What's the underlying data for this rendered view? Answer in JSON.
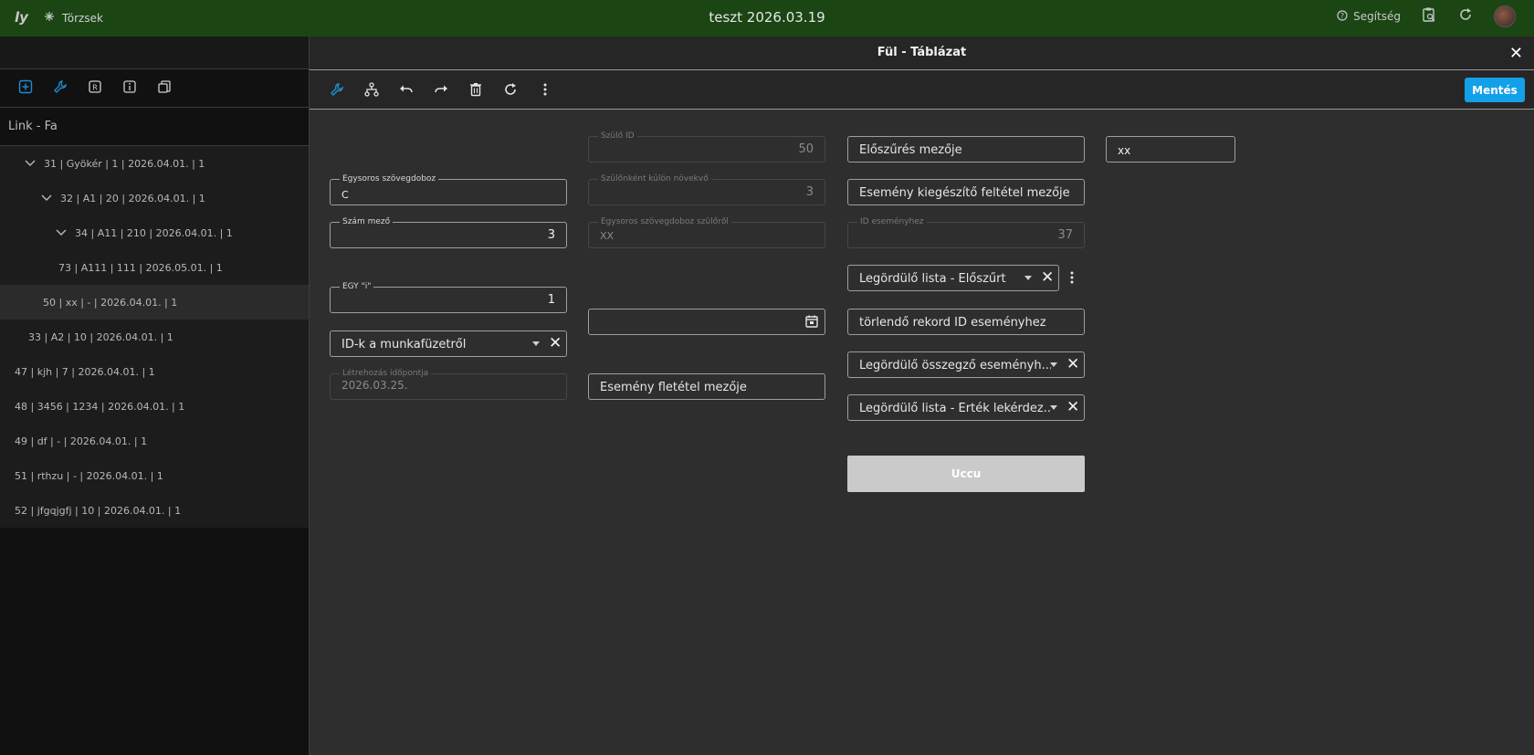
{
  "topbar": {
    "logo": "ly",
    "torzsek": "Törzsek",
    "title": "teszt 2026.03.19",
    "help": "Segítség"
  },
  "sidebar": {
    "title": "Link - Fa",
    "tree": [
      {
        "label": "31 | Gyökér | 1 | 2026.04.01. | 1",
        "indent": 1,
        "expanded": true
      },
      {
        "label": "32 | A1 | 20 | 2026.04.01. | 1",
        "indent": 2,
        "expanded": true
      },
      {
        "label": "34 | A11 | 210 | 2026.04.01. | 1",
        "indent": 3,
        "expanded": true
      },
      {
        "label": "73 | A111 | 111 | 2026.05.01. | 1",
        "indent": 4,
        "expanded": false
      },
      {
        "label": "50 | xx | - | 2026.04.01. | 1",
        "indent": 3,
        "expanded": false,
        "selected": true
      },
      {
        "label": "33 | A2 | 10 | 2026.04.01. | 1",
        "indent": 2,
        "expanded": false
      },
      {
        "label": "47 | kjh | 7 | 2026.04.01. | 1",
        "indent": 0,
        "expanded": false
      },
      {
        "label": "48 | 3456 | 1234 | 2026.04.01. | 1",
        "indent": 0,
        "expanded": false
      },
      {
        "label": "49 | df | - | 2026.04.01. | 1",
        "indent": 0,
        "expanded": false
      },
      {
        "label": "51 | rthzu | - | 2026.04.01. | 1",
        "indent": 0,
        "expanded": false
      },
      {
        "label": "52 | jfgqjgfj | 10 | 2026.04.01. | 1",
        "indent": 0,
        "expanded": false
      }
    ]
  },
  "main": {
    "title": "Fül - Táblázat",
    "save_label": "Mentés"
  },
  "form": {
    "egysoros": {
      "label": "Egysoros szövegdoboz",
      "value": "C"
    },
    "szam": {
      "label": "Szám mező",
      "value": "3"
    },
    "egy_i": {
      "label": "EGY \"i\"",
      "value": "1"
    },
    "idk": {
      "placeholder": "ID-k a munkafüzetről"
    },
    "letrehozas": {
      "label": "Létrehozás időpontja",
      "value": "2026.03.25."
    },
    "szulo_id": {
      "label": "Szülő ID",
      "value": "50"
    },
    "szulonkent": {
      "label": "Szülőnként külön növekvő",
      "value": "3"
    },
    "egysoros_szulo": {
      "label": "Egysoros szövegdoboz szülőről",
      "value": "XX"
    },
    "esemeny_feltetel": {
      "placeholder": "Esemény fletétel mezője"
    },
    "eloszures": {
      "placeholder": "Előszűrés mezője"
    },
    "esemeny_kieg": {
      "placeholder": "Esemény kiegészítő feltétel mezője"
    },
    "id_esemeny": {
      "label": "ID eseményhez",
      "value": "37"
    },
    "legordulo_eloszurt": {
      "placeholder": "Legördülő lista - Előszűrt"
    },
    "torlendo": {
      "placeholder": "törlendő rekord ID eseményhez"
    },
    "legordulo_osszegzo": {
      "placeholder": "Legördülő összegző eseményh..."
    },
    "legordulo_ertek": {
      "placeholder": "Legördülő lista - Érték lekérdez..."
    },
    "uccu": "Uccu",
    "xx": {
      "value": "xx"
    }
  },
  "colors": {
    "topbar": "#1b4614",
    "accent": "#13a0e8",
    "panel": "#2e2e2e"
  }
}
